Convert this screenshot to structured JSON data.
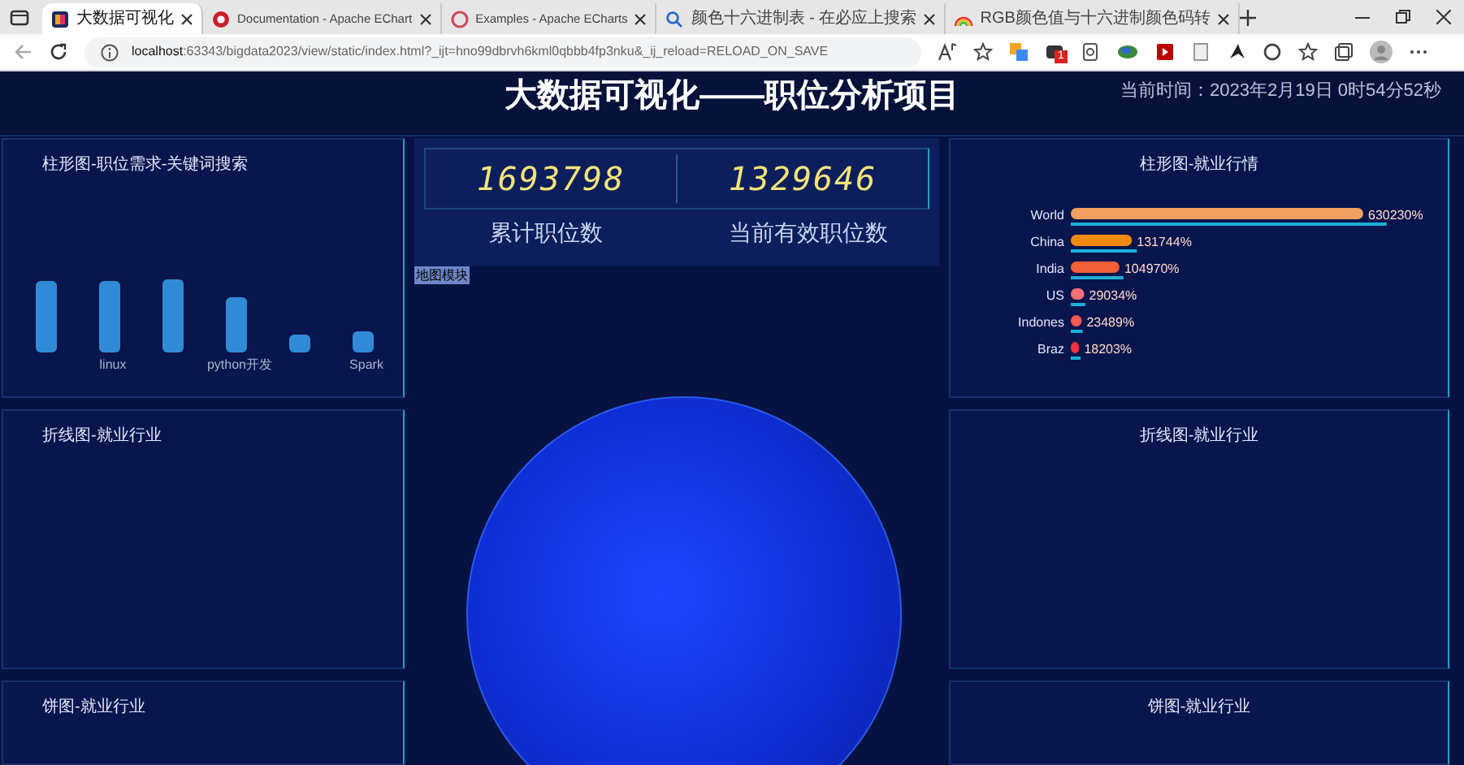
{
  "browser": {
    "tabs": [
      {
        "title": "大数据可视化",
        "selected": true
      },
      {
        "title": "Documentation - Apache EChart",
        "selected": false
      },
      {
        "title": "Examples - Apache ECharts",
        "selected": false
      },
      {
        "title": "颜色十六进制表 - 在必应上搜索",
        "selected": false
      },
      {
        "title": "RGB颜色值与十六进制颜色码转",
        "selected": false
      }
    ],
    "address": {
      "host": "localhost",
      "rest": ":63343/bigdata2023/view/static/index.html?_ijt=hno99dbrvh6kml0qbbb4fp3nku&_ij_reload=RELOAD_ON_SAVE"
    },
    "extension_badge": "1"
  },
  "header": {
    "title": "大数据可视化——职位分析项目",
    "time": "当前时间：2023年2月19日 0时54分52秒"
  },
  "counters": [
    {
      "value": "1693798",
      "label": "累计职位数"
    },
    {
      "value": "1329646",
      "label": "当前有效职位数"
    }
  ],
  "map_label": "地图模块",
  "panels_left": [
    {
      "title": "柱形图-职位需求-关键词搜索",
      "axis_labels": [
        "linux",
        "python开发",
        "Spark"
      ]
    },
    {
      "title": "折线图-就业行业"
    },
    {
      "title": "饼图-就业行业"
    }
  ],
  "panels_right": [
    {
      "title": "柱形图-就业行情",
      "chart_data": {
        "type": "bar",
        "orientation": "horizontal",
        "categories": [
          "World",
          "China",
          "India",
          "US",
          "Indones",
          "Braz"
        ],
        "values": [
          630230,
          131744,
          104970,
          29034,
          23489,
          18203
        ],
        "value_labels": [
          "630230%",
          "131744%",
          "104970%",
          "29034%",
          "23489%",
          "18203%"
        ]
      }
    },
    {
      "title": "折线图-就业行业"
    },
    {
      "title": "饼图-就业行业"
    }
  ]
}
